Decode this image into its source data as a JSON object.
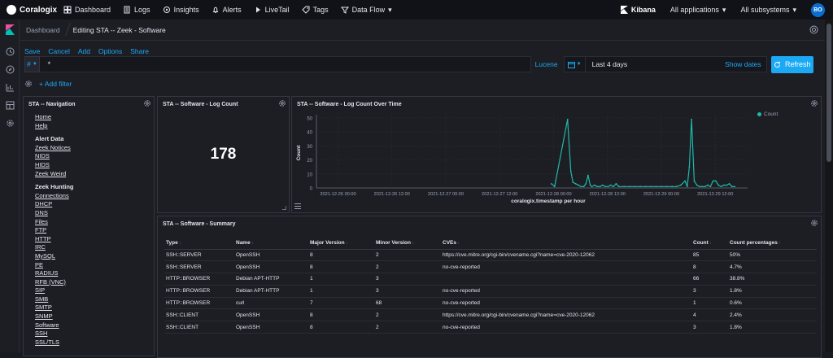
{
  "topbar": {
    "brand": "Coralogix",
    "nav": [
      {
        "label": "Dashboard",
        "icon": "dashboard-icon"
      },
      {
        "label": "Logs",
        "icon": "logs-icon"
      },
      {
        "label": "Insights",
        "icon": "insights-icon"
      },
      {
        "label": "Alerts",
        "icon": "bell-icon"
      },
      {
        "label": "LiveTail",
        "icon": "play-icon"
      },
      {
        "label": "Tags",
        "icon": "tag-icon"
      },
      {
        "label": "Data Flow",
        "icon": "data-flow-icon"
      }
    ],
    "kibana": "Kibana",
    "applications": "All applications",
    "subsystems": "All subsystems",
    "avatar": "BO"
  },
  "breadcrumb": {
    "parent": "Dashboard",
    "current": "Editing STA -- Zeek - Software"
  },
  "actions": [
    "Save",
    "Cancel",
    "Add",
    "Options",
    "Share"
  ],
  "query": {
    "lang_symbol": "#",
    "value": "*",
    "language": "Lucene",
    "date_range": "Last 4 days",
    "show_dates": "Show dates",
    "refresh": "Refresh"
  },
  "filter": {
    "add_filter": "+ Add filter"
  },
  "navigation_panel": {
    "title": "STA -- Navigation",
    "groups": [
      {
        "heading": "",
        "links": [
          "Home",
          "Help"
        ]
      },
      {
        "heading": "Alert Data",
        "links": [
          "Zeek Notices",
          "NIDS",
          "HIDS",
          "Zeek Weird"
        ]
      },
      {
        "heading": "Zeek Hunting",
        "links": [
          "Connections",
          "DHCP",
          "DNS",
          "Files",
          "FTP",
          "HTTP",
          "IRC",
          "MySQL",
          "PE",
          "RADIUS",
          "RFB (VNC)",
          "SIP",
          "SMB",
          "SMTP",
          "SNMP",
          "Software",
          "SSH",
          "SSL/TLS"
        ]
      }
    ]
  },
  "log_count_panel": {
    "title": "STA -- Software - Log Count",
    "value": "178"
  },
  "chart_panel": {
    "title": "STA -- Software - Log Count Over Time"
  },
  "chart_data": {
    "type": "line",
    "title": "STA -- Software - Log Count Over Time",
    "xlabel": "coralogix.timestamp per hour",
    "ylabel": "Count",
    "ylim": [
      0,
      50
    ],
    "yticks": [
      0,
      10,
      20,
      30,
      40,
      50
    ],
    "xticks": [
      "2021-12-26 00:00",
      "2021-12-26 12:00",
      "2021-12-27 00:00",
      "2021-12-27 12:00",
      "2021-12-28 00:00",
      "2021-12-28 12:00",
      "2021-12-29 00:00",
      "2021-12-29 12:00"
    ],
    "grid": true,
    "legend_position": "top-right",
    "color": "#20b7a8",
    "series": [
      {
        "name": "Count",
        "x": [
          43.6,
          44.2,
          46.6,
          47.2,
          47.6,
          48.1,
          48.6,
          49.1,
          49.6,
          50.0,
          50.4,
          50.8,
          51.1,
          51.6,
          52.1,
          52.6,
          53.1,
          53.6,
          54.1,
          54.6,
          55.1,
          55.6,
          56.1,
          57.1,
          58.1,
          59.1,
          60.1,
          61.1,
          62.1,
          63.0,
          64.0,
          65.0,
          66.0,
          66.8,
          67.6,
          68.4,
          68.8,
          69.2,
          69.6,
          70.1,
          70.6,
          71.1,
          71.6,
          72.1,
          72.6,
          73.1,
          73.6,
          74.1,
          74.6,
          75.1,
          75.6,
          76.1,
          76.6,
          77.1,
          77.6
        ],
        "y": [
          3,
          1,
          49,
          12,
          4,
          3,
          2,
          1,
          1,
          3,
          9,
          2,
          1,
          2,
          1,
          1,
          2,
          1,
          1,
          2,
          1,
          3,
          1,
          1,
          1,
          1,
          1,
          1,
          1,
          1,
          1,
          1,
          1,
          1,
          2,
          5,
          1,
          15,
          49,
          5,
          2,
          1,
          1,
          1,
          2,
          1,
          5,
          5,
          2,
          1,
          2,
          2,
          3,
          1,
          1
        ]
      }
    ]
  },
  "summary_panel": {
    "title": "STA -- Software - Summary",
    "columns": [
      "Type",
      "Name",
      "Major Version",
      "Minor Version",
      "CVEs",
      "Count",
      "Count percentages"
    ],
    "rows": [
      [
        "SSH::SERVER",
        "OpenSSH",
        "8",
        "2",
        "https://cve.mitre.org/cgi-bin/cvename.cgi?name=cve-2020-12062",
        "85",
        "50%"
      ],
      [
        "SSH::SERVER",
        "OpenSSH",
        "8",
        "2",
        "no-cve-reported",
        "8",
        "4.7%"
      ],
      [
        "HTTP::BROWSER",
        "Debian APT-HTTP",
        "1",
        "3",
        "",
        "66",
        "38.8%"
      ],
      [
        "HTTP::BROWSER",
        "Debian APT-HTTP",
        "1",
        "3",
        "no-cve-reported",
        "3",
        "1.8%"
      ],
      [
        "HTTP::BROWSER",
        "curl",
        "7",
        "68",
        "no-cve-reported",
        "1",
        "0.6%"
      ],
      [
        "SSH::CLIENT",
        "OpenSSH",
        "8",
        "2",
        "https://cve.mitre.org/cgi-bin/cvename.cgi?name=cve-2020-12062",
        "4",
        "2.4%"
      ],
      [
        "SSH::CLIENT",
        "OpenSSH",
        "8",
        "2",
        "no-cve-reported",
        "3",
        "1.8%"
      ]
    ]
  }
}
